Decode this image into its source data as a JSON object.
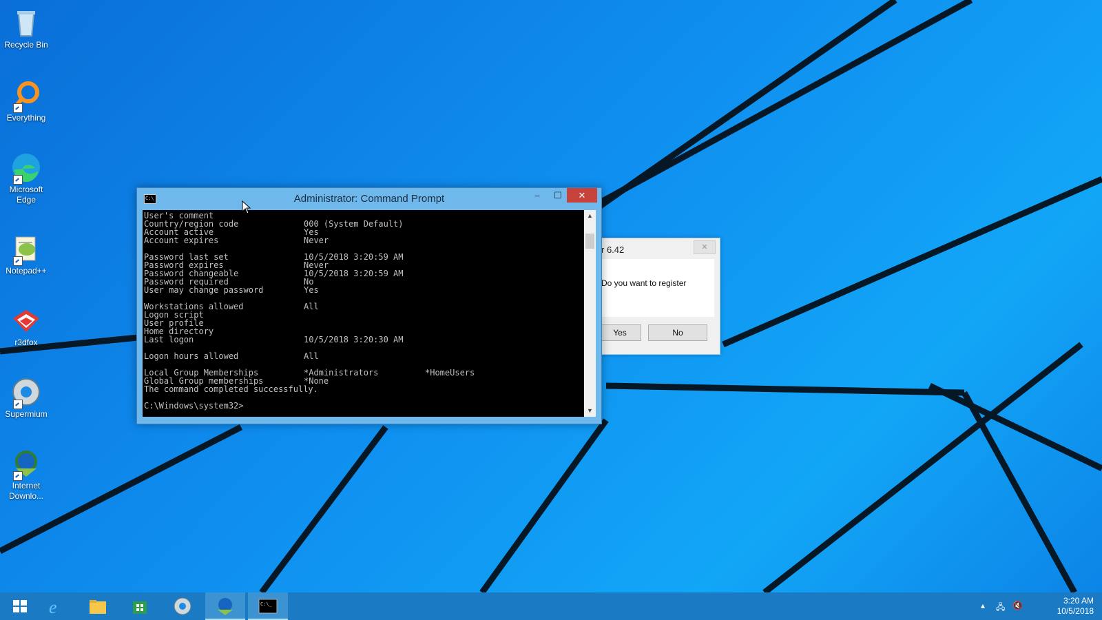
{
  "desktop": {
    "icons": [
      {
        "label": "Recycle Bin",
        "icon": "recycle-bin-icon"
      },
      {
        "label": "Everything",
        "icon": "everything-search-icon"
      },
      {
        "label": "Microsoft Edge",
        "icon": "edge-icon"
      },
      {
        "label": "Notepad++",
        "icon": "notepad-plus-plus-icon"
      },
      {
        "label": "r3dfox",
        "icon": "r3dfox-icon"
      },
      {
        "label": "Supermium",
        "icon": "supermium-icon"
      },
      {
        "label": "Internet Downlo...",
        "icon": "internet-download-manager-icon"
      }
    ]
  },
  "cmd": {
    "title": "Administrator: Command Prompt",
    "controls": {
      "minimize": "–",
      "maximize": "☐",
      "close": "✕"
    },
    "rows": [
      [
        "User's comment",
        "",
        ""
      ],
      [
        "Country/region code",
        "000 (System Default)",
        ""
      ],
      [
        "Account active",
        "Yes",
        ""
      ],
      [
        "Account expires",
        "Never",
        ""
      ],
      [
        "",
        "",
        ""
      ],
      [
        "Password last set",
        "10/5/2018 3:20:59 AM",
        ""
      ],
      [
        "Password expires",
        "Never",
        ""
      ],
      [
        "Password changeable",
        "10/5/2018 3:20:59 AM",
        ""
      ],
      [
        "Password required",
        "No",
        ""
      ],
      [
        "User may change password",
        "Yes",
        ""
      ],
      [
        "",
        "",
        ""
      ],
      [
        "Workstations allowed",
        "All",
        ""
      ],
      [
        "Logon script",
        "",
        ""
      ],
      [
        "User profile",
        "",
        ""
      ],
      [
        "Home directory",
        "",
        ""
      ],
      [
        "Last logon",
        "10/5/2018 3:20:30 AM",
        ""
      ],
      [
        "",
        "",
        ""
      ],
      [
        "Logon hours allowed",
        "All",
        ""
      ],
      [
        "",
        "",
        ""
      ],
      [
        "Local Group Memberships",
        "*Administrators",
        "*HomeUsers"
      ],
      [
        "Global Group memberships",
        "*None",
        ""
      ],
      [
        "The command completed successfully.",
        "",
        ""
      ],
      [
        "",
        "",
        ""
      ],
      [
        "C:\\Windows\\system32>",
        "",
        ""
      ]
    ]
  },
  "dialog": {
    "title": "r 6.42",
    "message": "Do you want to register",
    "yes_label": "Yes",
    "no_label": "No",
    "close_label": "✕"
  },
  "taskbar": {
    "items": [
      "start-button",
      "internet-explorer",
      "file-explorer",
      "store",
      "supermium",
      "internet-download-manager",
      "command-prompt"
    ],
    "active": "command-prompt",
    "time": "3:20 AM",
    "date": "10/5/2018"
  },
  "colors": {
    "accent": "#1a7bc4",
    "title_active": "#6fb8ec",
    "close_red": "#c7423a"
  }
}
